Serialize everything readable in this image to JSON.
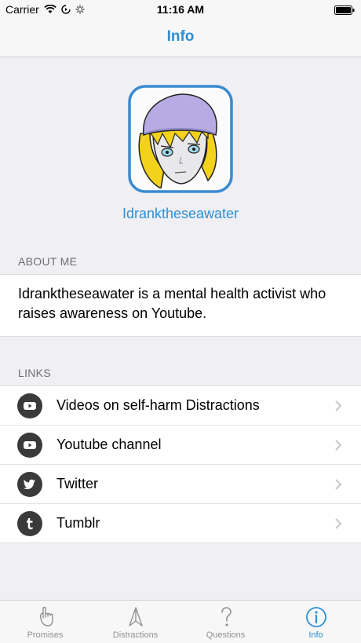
{
  "status": {
    "carrier": "Carrier",
    "time": "11:16 AM"
  },
  "nav": {
    "title": "Info"
  },
  "profile": {
    "name": "Idranktheseawater"
  },
  "about": {
    "header": "ABOUT ME",
    "text": "Idranktheseawater is a mental health activist who raises awareness on Youtube."
  },
  "links": {
    "header": "LINKS",
    "items": [
      {
        "label": "Videos on self-harm Distractions",
        "icon": "youtube-icon"
      },
      {
        "label": "Youtube channel",
        "icon": "youtube-icon"
      },
      {
        "label": "Twitter",
        "icon": "twitter-icon"
      },
      {
        "label": "Tumblr",
        "icon": "tumblr-icon"
      }
    ]
  },
  "tabs": [
    {
      "label": "Promises",
      "icon": "hand-pinky-icon",
      "active": false
    },
    {
      "label": "Distractions",
      "icon": "paper-plane-icon",
      "active": false
    },
    {
      "label": "Questions",
      "icon": "question-icon",
      "active": false
    },
    {
      "label": "Info",
      "icon": "info-icon",
      "active": true
    }
  ],
  "colors": {
    "accent": "#2c8fd6",
    "background": "#efeff4",
    "icon_dark": "#3a3a3a"
  }
}
